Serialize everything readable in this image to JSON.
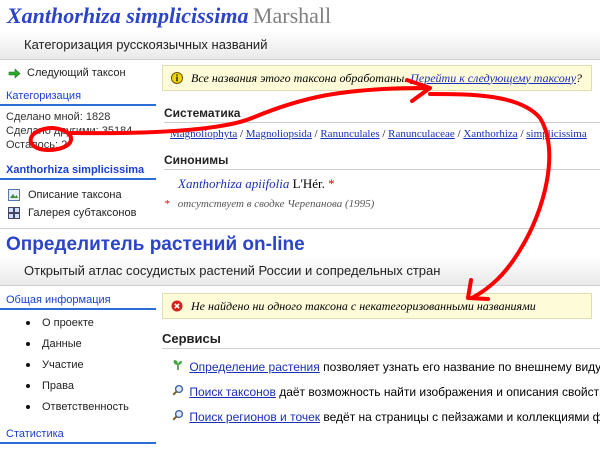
{
  "top_panel": {
    "title_latin": "Xanthorhiza simplicissima",
    "title_author": "Marshall",
    "subtitle": "Категоризация русскоязычных названий",
    "sidebar": {
      "next_taxon": "Следующий таксон",
      "categorization_heading": "Категоризация",
      "done_by_me": "Сделано мной: 1828",
      "done_by_others": "Сделано другими: 35184",
      "remaining_label": "Осталось:",
      "remaining_value": "2",
      "taxon_heading": "Xanthorhiza simplicissima",
      "taxon_description": "Описание таксона",
      "subtaxa_gallery": "Галерея субтаксонов"
    },
    "notice": {
      "text": "Все названия этого таксона обработаны.",
      "link": "Перейти к следующему таксону",
      "end": "?"
    },
    "systematics": {
      "heading": "Систематика",
      "crumbs": [
        "Magnoliophyta",
        "Magnoliopsida",
        "Ranunculales",
        "Ranunculaceae",
        "Xanthorhiza",
        "simplicissima"
      ],
      "separator": " / "
    },
    "synonyms": {
      "heading": "Синонимы",
      "items": [
        {
          "latin": "Xanthorhiza apiifolia",
          "author": "L'Hér.",
          "mark": "*"
        }
      ],
      "footnote_mark": "*",
      "footnote_text": "отсутствует в сводке Черепанова (1995)"
    }
  },
  "bottom_panel": {
    "title": "Определитель растений on-line",
    "subtitle": "Открытый атлас сосудистых растений России и сопредельных стран",
    "sidebar": {
      "general_heading": "Общая информация",
      "items": [
        "О проекте",
        "Данные",
        "Участие",
        "Права",
        "Ответственность"
      ],
      "statistics_heading": "Статистика"
    },
    "error": "Не найдено ни одного таксона с некатегоризованными названиями",
    "services": {
      "heading": "Сервисы",
      "items": [
        {
          "link": "Определение растения",
          "text": "позволяет узнать его название по внешнему виду."
        },
        {
          "link": "Поиск таксонов",
          "text": "даёт возможность найти изображения и описания свойств растений"
        },
        {
          "link": "Поиск регионов и точек",
          "text": "ведёт на страницы с пейзажами и коллекциями фото"
        }
      ]
    }
  },
  "colors": {
    "annotation": "#ff0000",
    "heading_blue": "#2b44c8",
    "link_blue": "#1a2fb5",
    "notice_bg": "#fdfbd8"
  }
}
